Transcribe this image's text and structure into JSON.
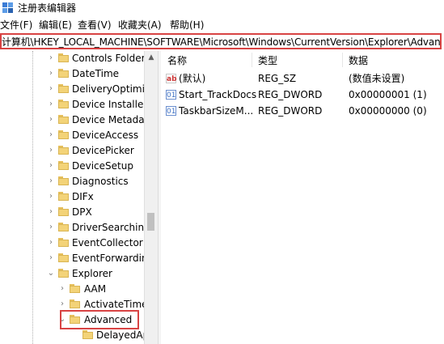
{
  "window": {
    "title": "注册表编辑器"
  },
  "menu": [
    {
      "label": "文件(F)"
    },
    {
      "label": "编辑(E)"
    },
    {
      "label": "查看(V)"
    },
    {
      "label": "收藏夹(A)"
    },
    {
      "label": "帮助(H)"
    }
  ],
  "address": {
    "path": "计算机\\HKEY_LOCAL_MACHINE\\SOFTWARE\\Microsoft\\Windows\\CurrentVersion\\Explorer\\Advanced"
  },
  "tree": {
    "items": [
      {
        "label": "Controls Folder",
        "expander": "›"
      },
      {
        "label": "DateTime",
        "expander": "›"
      },
      {
        "label": "DeliveryOptimiza",
        "expander": "›"
      },
      {
        "label": "Device Installer",
        "expander": "›"
      },
      {
        "label": "Device Metadata",
        "expander": "›"
      },
      {
        "label": "DeviceAccess",
        "expander": "›"
      },
      {
        "label": "DevicePicker",
        "expander": "›"
      },
      {
        "label": "DeviceSetup",
        "expander": "›"
      },
      {
        "label": "Diagnostics",
        "expander": "›"
      },
      {
        "label": "DIFx",
        "expander": "›"
      },
      {
        "label": "DPX",
        "expander": "›"
      },
      {
        "label": "DriverSearching",
        "expander": "›"
      },
      {
        "label": "EventCollector",
        "expander": "›"
      },
      {
        "label": "EventForwarding",
        "expander": "›"
      },
      {
        "label": "Explorer",
        "expander": "⌄"
      },
      {
        "label": "AAM",
        "expander": "›"
      },
      {
        "label": "ActivateTimec",
        "expander": "›"
      },
      {
        "label": "Advanced",
        "expander": "⌄"
      },
      {
        "label": "DelayedAp",
        "expander": ""
      }
    ]
  },
  "values": {
    "headers": {
      "name": "名称",
      "type": "类型",
      "data": "数据"
    },
    "rows": [
      {
        "icon": "ab",
        "name": "(默认)",
        "type": "REG_SZ",
        "data": "(数值未设置)"
      },
      {
        "icon": "01",
        "name": "Start_TrackDocs",
        "type": "REG_DWORD",
        "data": "0x00000001 (1)"
      },
      {
        "icon": "01",
        "name": "TaskbarSizeM...",
        "type": "REG_DWORD",
        "data": "0x00000000 (0)"
      }
    ]
  },
  "colors": {
    "highlight": "#d84343",
    "folder": "#f3d378"
  }
}
